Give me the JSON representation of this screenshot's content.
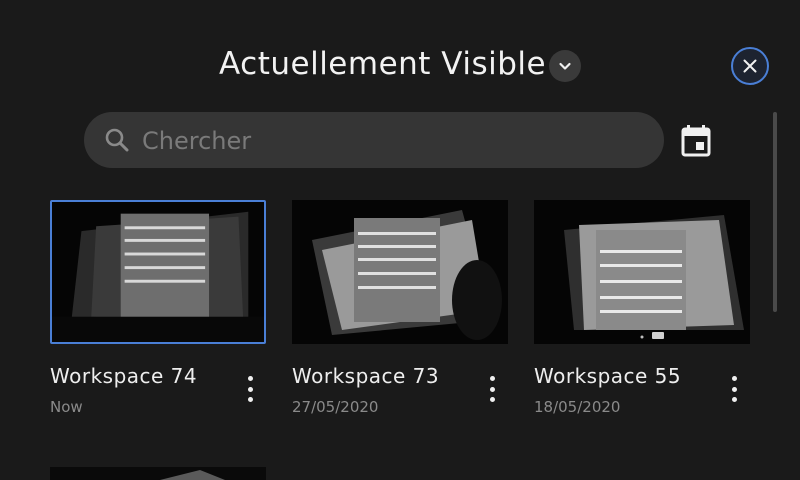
{
  "header": {
    "title": "Actuellement Visible"
  },
  "search": {
    "placeholder": "Chercher",
    "value": ""
  },
  "icons": {
    "dropdown": "chevron-down-icon",
    "close": "close-icon",
    "search": "search-icon",
    "calendar": "calendar-icon",
    "more": "more-vert-icon"
  },
  "colors": {
    "background": "#1a1a1a",
    "accent": "#4a7fd6",
    "search_bg": "#353535"
  },
  "workspaces": [
    {
      "name": "Workspace 74",
      "date": "Now",
      "selected": true
    },
    {
      "name": "Workspace 73",
      "date": "27/05/2020",
      "selected": false
    },
    {
      "name": "Workspace 55",
      "date": "18/05/2020",
      "selected": false
    }
  ]
}
